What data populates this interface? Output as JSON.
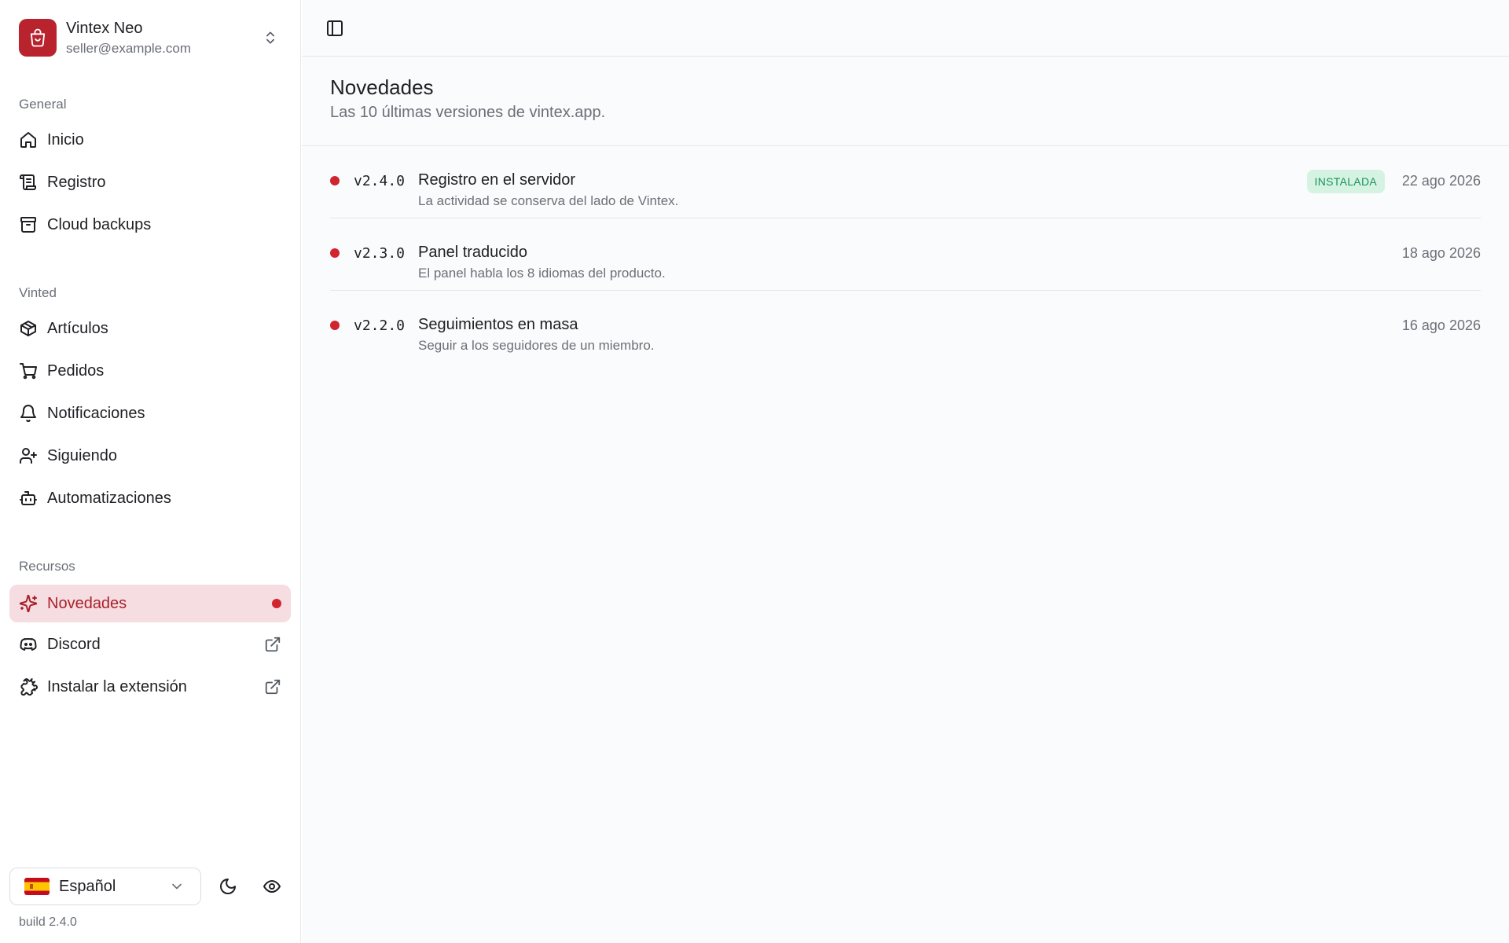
{
  "account": {
    "name": "Vintex Neo",
    "email": "seller@example.com"
  },
  "sidebar": {
    "sections": [
      {
        "label": "General",
        "items": [
          {
            "label": "Inicio",
            "icon": "home-icon"
          },
          {
            "label": "Registro",
            "icon": "scroll-icon"
          },
          {
            "label": "Cloud backups",
            "icon": "archive-icon"
          }
        ]
      },
      {
        "label": "Vinted",
        "items": [
          {
            "label": "Artículos",
            "icon": "package-icon"
          },
          {
            "label": "Pedidos",
            "icon": "cart-icon"
          },
          {
            "label": "Notificaciones",
            "icon": "bell-icon"
          },
          {
            "label": "Siguiendo",
            "icon": "user-plus-icon"
          },
          {
            "label": "Automatizaciones",
            "icon": "bot-icon"
          }
        ]
      },
      {
        "label": "Recursos",
        "items": [
          {
            "label": "Novedades",
            "icon": "sparkles-icon",
            "active": true,
            "has_dot": true
          },
          {
            "label": "Discord",
            "icon": "discord-icon",
            "external": true
          },
          {
            "label": "Instalar la extensión",
            "icon": "puzzle-icon",
            "external": true
          }
        ]
      }
    ],
    "language": {
      "selected": "Español",
      "flag": "es-flag"
    },
    "build": "build 2.4.0"
  },
  "page": {
    "title": "Novedades",
    "subtitle": "Las 10 últimas versiones de vintex.app."
  },
  "releases": [
    {
      "version": "v2.4.0",
      "title": "Registro en el servidor",
      "description": "La actividad se conserva del lado de Vintex.",
      "badge": "INSTALADA",
      "date": "22 ago 2026"
    },
    {
      "version": "v2.3.0",
      "title": "Panel traducido",
      "description": "El panel habla los 8 idiomas del producto.",
      "date": "18 ago 2026"
    },
    {
      "version": "v2.2.0",
      "title": "Seguimientos en masa",
      "description": "Seguir a los seguidores de un miembro.",
      "date": "16 ago 2026"
    }
  ],
  "colors": {
    "brand": "#b8232d",
    "active_bg": "#f6dde1",
    "active_text": "#a8222c",
    "unread_dot": "#d0242f",
    "badge_bg": "#d6f2e3",
    "badge_text": "#15955a"
  }
}
